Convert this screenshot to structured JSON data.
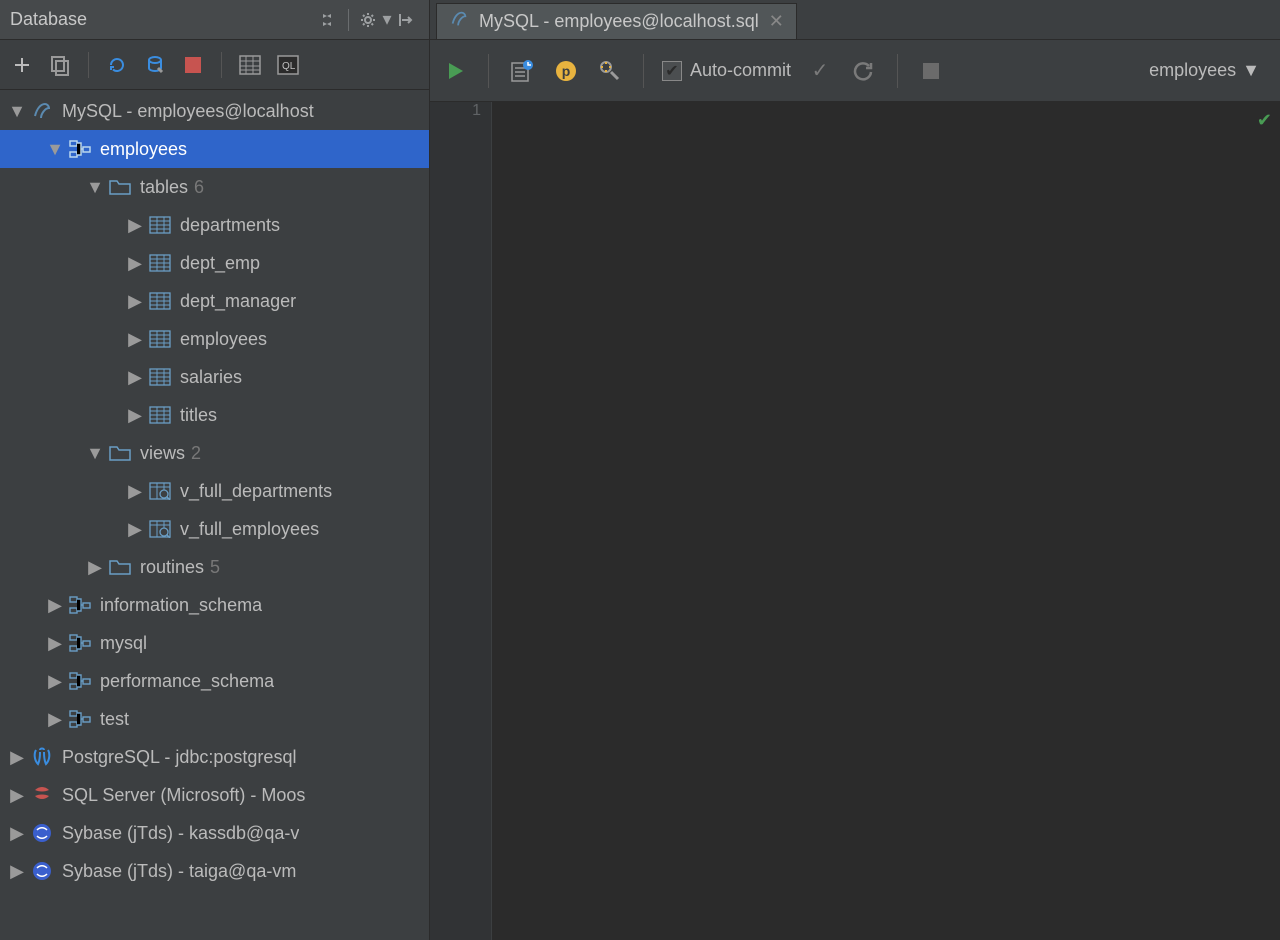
{
  "sidebar": {
    "title": "Database",
    "tree": {
      "mysql_conn": "MySQL - employees@localhost",
      "employees": "employees",
      "tables_label": "tables",
      "tables_count": "6",
      "tables": {
        "0": "departments",
        "1": "dept_emp",
        "2": "dept_manager",
        "3": "employees",
        "4": "salaries",
        "5": "titles"
      },
      "views_label": "views",
      "views_count": "2",
      "views": {
        "0": "v_full_departments",
        "1": "v_full_employees"
      },
      "routines_label": "routines",
      "routines_count": "5",
      "info_schema": "information_schema",
      "mysql_schema": "mysql",
      "perf_schema": "performance_schema",
      "test_schema": "test",
      "postgres": "PostgreSQL - jdbc:postgresql",
      "sqlserver": "SQL Server (Microsoft) - Moos",
      "sybase1": "Sybase (jTds) - kassdb@qa-v",
      "sybase2": "Sybase (jTds) - taiga@qa-vm"
    }
  },
  "tab": {
    "title": "MySQL - employees@localhost.sql"
  },
  "editor_toolbar": {
    "auto_commit": "Auto-commit",
    "schema": "employees"
  },
  "gutter": {
    "line1": "1"
  }
}
